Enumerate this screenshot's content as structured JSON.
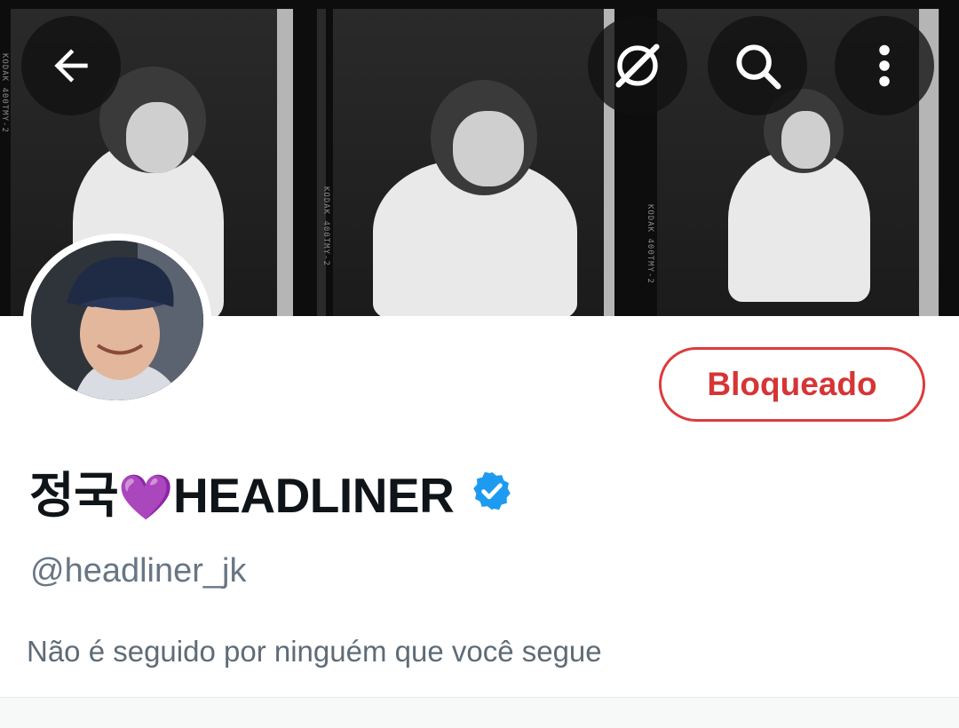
{
  "header": {
    "back_icon": "arrow-left-icon",
    "grok_icon": "grok-icon",
    "search_icon": "search-icon",
    "more_icon": "more-vertical-icon"
  },
  "banner": {
    "edge_labels": [
      "KODAK 400TMY-2",
      "KODAK 400TMY-2",
      "KODAK 400TMY-2"
    ]
  },
  "profile": {
    "name_prefix": "정국",
    "name_emoji": "💜",
    "name_suffix": "HEADLINER",
    "verified_icon": "verified-badge-icon",
    "handle": "@headliner_jk",
    "followers_note": "Não é seguido por ninguém que você segue"
  },
  "actions": {
    "block_label": "Bloqueado"
  },
  "colors": {
    "block_red": "#d63535",
    "verified_blue": "#1d9bf0",
    "handle_gray": "#687684"
  }
}
